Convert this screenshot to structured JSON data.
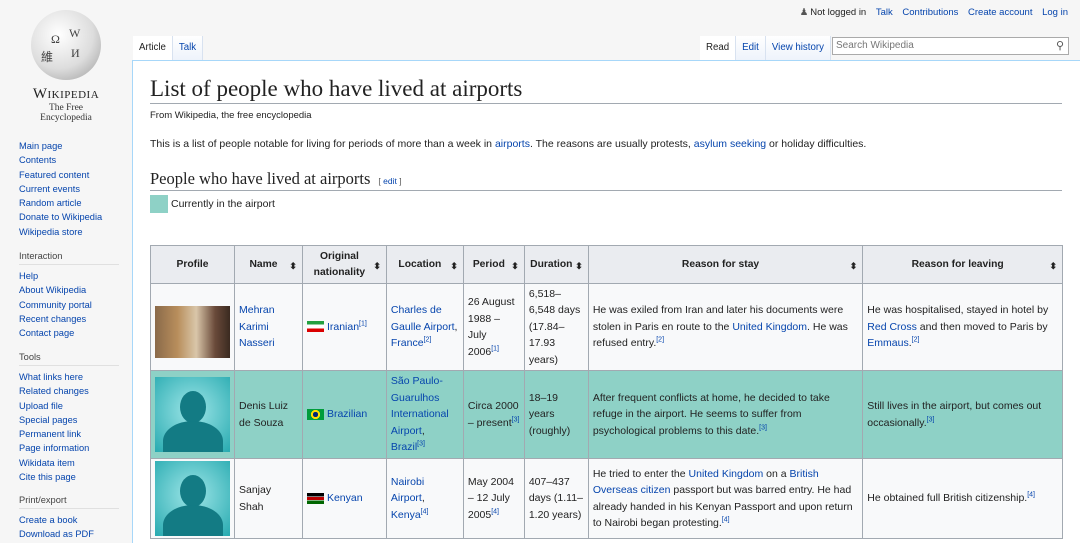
{
  "logo": {
    "wordmark": "Wikipedia",
    "tagline": "The Free Encyclopedia"
  },
  "sidebar": {
    "main": [
      "Main page",
      "Contents",
      "Featured content",
      "Current events",
      "Random article",
      "Donate to Wikipedia",
      "Wikipedia store"
    ],
    "interaction": {
      "title": "Interaction",
      "items": [
        "Help",
        "About Wikipedia",
        "Community portal",
        "Recent changes",
        "Contact page"
      ]
    },
    "tools": {
      "title": "Tools",
      "items": [
        "What links here",
        "Related changes",
        "Upload file",
        "Special pages",
        "Permanent link",
        "Page information",
        "Wikidata item",
        "Cite this page"
      ]
    },
    "print": {
      "title": "Print/export",
      "items": [
        "Create a book",
        "Download as PDF"
      ]
    }
  },
  "personal": {
    "status": "Not logged in",
    "links": [
      "Talk",
      "Contributions",
      "Create account",
      "Log in"
    ]
  },
  "tabs": {
    "left": [
      "Article",
      "Talk"
    ],
    "right": [
      "Read",
      "Edit",
      "View history"
    ]
  },
  "search": {
    "placeholder": "Search Wikipedia"
  },
  "page": {
    "title": "List of people who have lived at airports",
    "subtitle": "From Wikipedia, the free encyclopedia",
    "intro": [
      {
        "t": "This is a list of people notable for living for periods of more than a week in "
      },
      {
        "t": "airports",
        "link": true
      },
      {
        "t": ". The reasons are usually protests, "
      },
      {
        "t": "asylum seeking",
        "link": true
      },
      {
        "t": " or holiday difficulties."
      }
    ],
    "section": "People who have lived at airports",
    "edit": "edit",
    "legend": "Currently in the airport",
    "legend_color": "#8ed1c6"
  },
  "table": {
    "headers": [
      "Profile",
      "Name",
      "Original nationality",
      "Location",
      "Period",
      "Duration",
      "Reason for stay",
      "Reason for leaving"
    ],
    "rows": [
      {
        "current": false,
        "image": "photo",
        "flag": "ir",
        "name": [
          {
            "t": "Mehran Karimi Nasseri",
            "link": true
          }
        ],
        "nationality": [
          {
            "t": "Iranian",
            "link": true
          },
          {
            "t": "[1]",
            "sup": true
          }
        ],
        "location": [
          {
            "t": "Charles de Gaulle Airport",
            "link": true
          },
          {
            "t": ", "
          },
          {
            "t": "France",
            "link": true
          },
          {
            "t": "[2]",
            "sup": true
          }
        ],
        "period": [
          {
            "t": "26 August 1988 – July 2006"
          },
          {
            "t": "[1]",
            "sup": true
          }
        ],
        "duration": [
          {
            "t": "6,518–6,548 days (17.84–17.93 years)"
          }
        ],
        "stay": [
          {
            "t": "He was exiled from Iran and later his documents were stolen in Paris en route to the "
          },
          {
            "t": "United Kingdom",
            "link": true
          },
          {
            "t": ". He was refused entry."
          },
          {
            "t": "[2]",
            "sup": true
          }
        ],
        "leaving": [
          {
            "t": "He was hospitalised, stayed in hotel by "
          },
          {
            "t": "Red Cross",
            "link": true
          },
          {
            "t": " and then moved to Paris by "
          },
          {
            "t": "Emmaus",
            "link": true
          },
          {
            "t": "."
          },
          {
            "t": "[2]",
            "sup": true
          }
        ]
      },
      {
        "current": true,
        "image": "silhouette",
        "flag": "br",
        "name": [
          {
            "t": "Denis Luiz de Souza"
          }
        ],
        "nationality": [
          {
            "t": "Brazilian",
            "link": true
          }
        ],
        "location": [
          {
            "t": "São Paulo-Guarulhos International Airport",
            "link": true
          },
          {
            "t": ", "
          },
          {
            "t": "Brazil",
            "link": true
          },
          {
            "t": "[3]",
            "sup": true
          }
        ],
        "period": [
          {
            "t": "Circa 2000 – present"
          },
          {
            "t": "[3]",
            "sup": true
          }
        ],
        "duration": [
          {
            "t": "18–19 years (roughly)"
          }
        ],
        "stay": [
          {
            "t": "After frequent conflicts at home, he decided to take refuge in the airport. He seems to suffer from psychological problems to this date."
          },
          {
            "t": "[3]",
            "sup": true
          }
        ],
        "leaving": [
          {
            "t": "Still lives in the airport, but comes out occasionally."
          },
          {
            "t": "[3]",
            "sup": true
          }
        ]
      },
      {
        "current": false,
        "image": "silhouette",
        "flag": "ke",
        "name": [
          {
            "t": "Sanjay Shah"
          }
        ],
        "nationality": [
          {
            "t": "Kenyan",
            "link": true
          }
        ],
        "location": [
          {
            "t": "Nairobi Airport",
            "link": true
          },
          {
            "t": ", "
          },
          {
            "t": "Kenya",
            "link": true
          },
          {
            "t": "[4]",
            "sup": true
          }
        ],
        "period": [
          {
            "t": "May 2004 – 12 July 2005"
          },
          {
            "t": "[4]",
            "sup": true
          }
        ],
        "duration": [
          {
            "t": "407–437 days (1.11–1.20 years)"
          }
        ],
        "stay": [
          {
            "t": "He tried to enter the "
          },
          {
            "t": "United Kingdom",
            "link": true
          },
          {
            "t": " on a "
          },
          {
            "t": "British Overseas citizen",
            "link": true
          },
          {
            "t": " passport but was barred entry. He had already handed in his Kenyan Passport and upon return to Nairobi began protesting."
          },
          {
            "t": "[4]",
            "sup": true
          }
        ],
        "leaving": [
          {
            "t": "He obtained full British citizenship."
          },
          {
            "t": "[4]",
            "sup": true
          }
        ]
      }
    ]
  }
}
